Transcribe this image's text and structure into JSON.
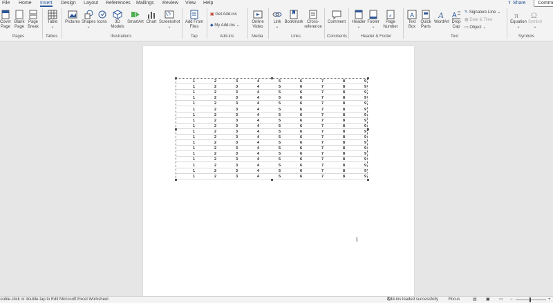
{
  "tabs": [
    "File",
    "Home",
    "Insert",
    "Design",
    "Layout",
    "References",
    "Mailings",
    "Review",
    "View",
    "Help"
  ],
  "share_label": "Share",
  "comments_label": "Comme",
  "ribbon": {
    "pages": {
      "cover": "Cover",
      "cover2": "Page",
      "blank": "Blank",
      "blank2": "Page",
      "break": "Page",
      "break2": "Break",
      "group": "Pages"
    },
    "tables": {
      "table": "Table",
      "group": "Tables"
    },
    "illustrations": {
      "pictures": "Pictures",
      "shapes": "Shapes",
      "icons": "Icons",
      "models": "3D",
      "models2": "Models",
      "smartart": "SmartArt",
      "chart": "Chart",
      "screenshot": "Screenshot",
      "group": "Illustrations"
    },
    "tap": {
      "addfrom": "Add From",
      "addfrom2": "Files",
      "group": "Tap"
    },
    "addins": {
      "get": "Get Add-ins",
      "my": "My Add-ins",
      "group": "Add-ins"
    },
    "media": {
      "online": "Online",
      "online2": "Video",
      "group": "Media"
    },
    "links": {
      "link": "Link",
      "bookmark": "Bookmark",
      "crossref": "Cross-",
      "crossref2": "reference",
      "group": "Links"
    },
    "comments": {
      "comment": "Comment",
      "group": "Comments"
    },
    "headerfooter": {
      "header": "Header",
      "footer": "Footer",
      "pagenum": "Page",
      "pagenum2": "Number",
      "group": "Header & Footer"
    },
    "text": {
      "textbox": "Text",
      "textbox2": "Box",
      "quickparts": "Quick",
      "quickparts2": "Parts",
      "wordart": "WordArt",
      "dropcap": "Drop",
      "dropcap2": "Cap",
      "sigline": "Signature Line",
      "datetime": "Date & Time",
      "object": "Object",
      "group": "Text"
    },
    "symbols": {
      "equation": "Equation",
      "symbol": "Symbol",
      "group": "Symbols"
    }
  },
  "table_data": {
    "row_count": 18,
    "values": [
      "1",
      "2",
      "3",
      "4",
      "5",
      "6",
      "7",
      "8",
      "9"
    ]
  },
  "status": {
    "hint": "Double-click or double-tap to Edit Microsoft Excel Worksheet",
    "addins": "Add-ins loaded successfully",
    "focus": "Focus"
  },
  "colors": {
    "accent": "#2b579a"
  }
}
